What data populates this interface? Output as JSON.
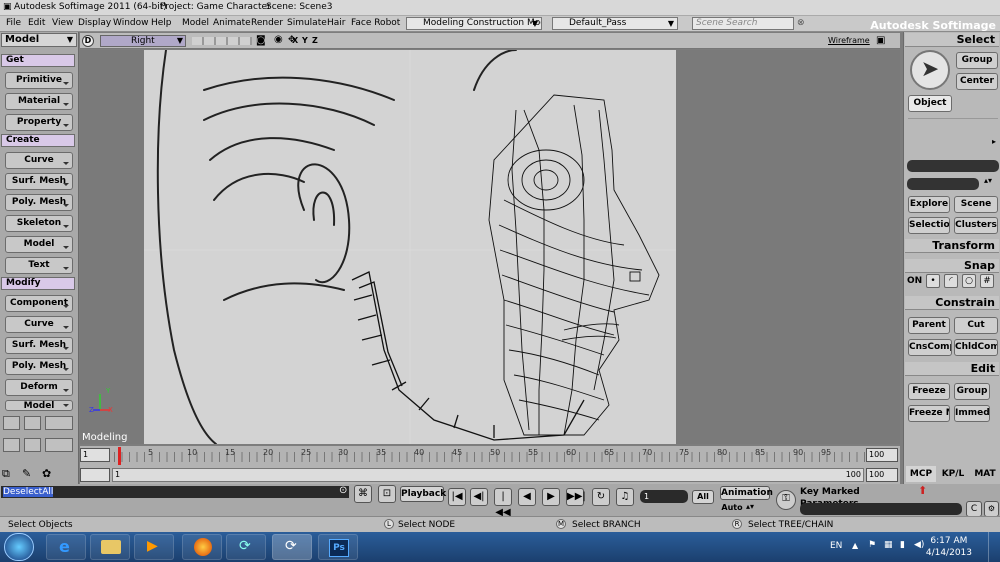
{
  "window": {
    "title": "Autodesk Softimage 2011 (64-bit)",
    "project": "Project: Game Character",
    "scene": "Scene: Scene3",
    "brand": "Autodesk Softimage"
  },
  "menu": {
    "items": [
      "File",
      "Edit",
      "View",
      "Display",
      "Window",
      "Help",
      "Model",
      "Animate",
      "Render",
      "Simulate",
      "Hair",
      "Face Robot"
    ],
    "construction_mode": "Modeling Construction Mode",
    "pass": "Default_Pass",
    "search_placeholder": "Scene Search"
  },
  "left_panel": {
    "mode": "Model",
    "sections": [
      {
        "title": "Get",
        "buttons": [
          "Primitive",
          "Material",
          "Property"
        ]
      },
      {
        "title": "Create",
        "buttons": [
          "Curve",
          "Surf. Mesh",
          "Poly. Mesh",
          "Skeleton",
          "Model",
          "Text"
        ]
      },
      {
        "title": "Modify",
        "buttons": [
          "Component",
          "Curve",
          "Surf. Mesh",
          "Poly. Mesh",
          "Deform",
          "Model"
        ]
      }
    ]
  },
  "viewport": {
    "view": "Right",
    "axes": [
      "X",
      "Y",
      "Z"
    ],
    "display_mode": "Wireframe",
    "label": "Modeling",
    "gizmo": {
      "y": "Y",
      "z": "Z",
      "x": "X"
    }
  },
  "timeline": {
    "start_frame": "1",
    "end_frame": "100",
    "ticks": [
      "5",
      "10",
      "15",
      "20",
      "25",
      "30",
      "35",
      "40",
      "45",
      "50",
      "55",
      "60",
      "65",
      "70",
      "75",
      "80",
      "85",
      "90",
      "95"
    ],
    "range_start": "1",
    "range_end": "100",
    "range_end_field": "100",
    "current_frame": "1"
  },
  "right_panel": {
    "select_header": "Select",
    "group_btn": "Group",
    "center_btn": "Center",
    "object_btn": "Object",
    "explore_btn": "Explore",
    "scene_btn": "Scene",
    "selection_btn": "Selection",
    "clusters_btn": "Clusters",
    "transform_header": "Transform",
    "snap_header": "Snap",
    "snap_on": "ON",
    "constrain_header": "Constrain",
    "parent_btn": "Parent",
    "cut_btn": "Cut",
    "cnscomp_btn": "CnsComp",
    "chldcomp_btn": "ChldComp",
    "edit_header": "Edit",
    "freeze_btn": "Freeze",
    "group2_btn": "Group",
    "freezem_btn": "Freeze M",
    "immed_btn": "Immed",
    "tabs": [
      "MCP",
      "KP/L",
      "MAT"
    ]
  },
  "bottom": {
    "command": "DeselectAll",
    "playback": "Playback",
    "all": "All",
    "animation": "Animation",
    "auto": "Auto",
    "key_marked": "Key Marked Parameters",
    "status_left": "Select Objects",
    "mouse_l": "L",
    "status_l": "Select NODE",
    "mouse_m": "M",
    "status_m": "Select BRANCH",
    "mouse_r": "R",
    "status_r": "Select TREE/CHAIN",
    "frame_field": "1"
  },
  "taskbar": {
    "lang": "EN",
    "time": "6:17 AM",
    "date": "4/14/2013",
    "apps": [
      "windows-start-icon",
      "internet-explorer-icon",
      "file-explorer-icon",
      "media-player-icon",
      "firefox-icon",
      "softimage-icon",
      "softimage-icon-2",
      "photoshop-icon"
    ]
  }
}
